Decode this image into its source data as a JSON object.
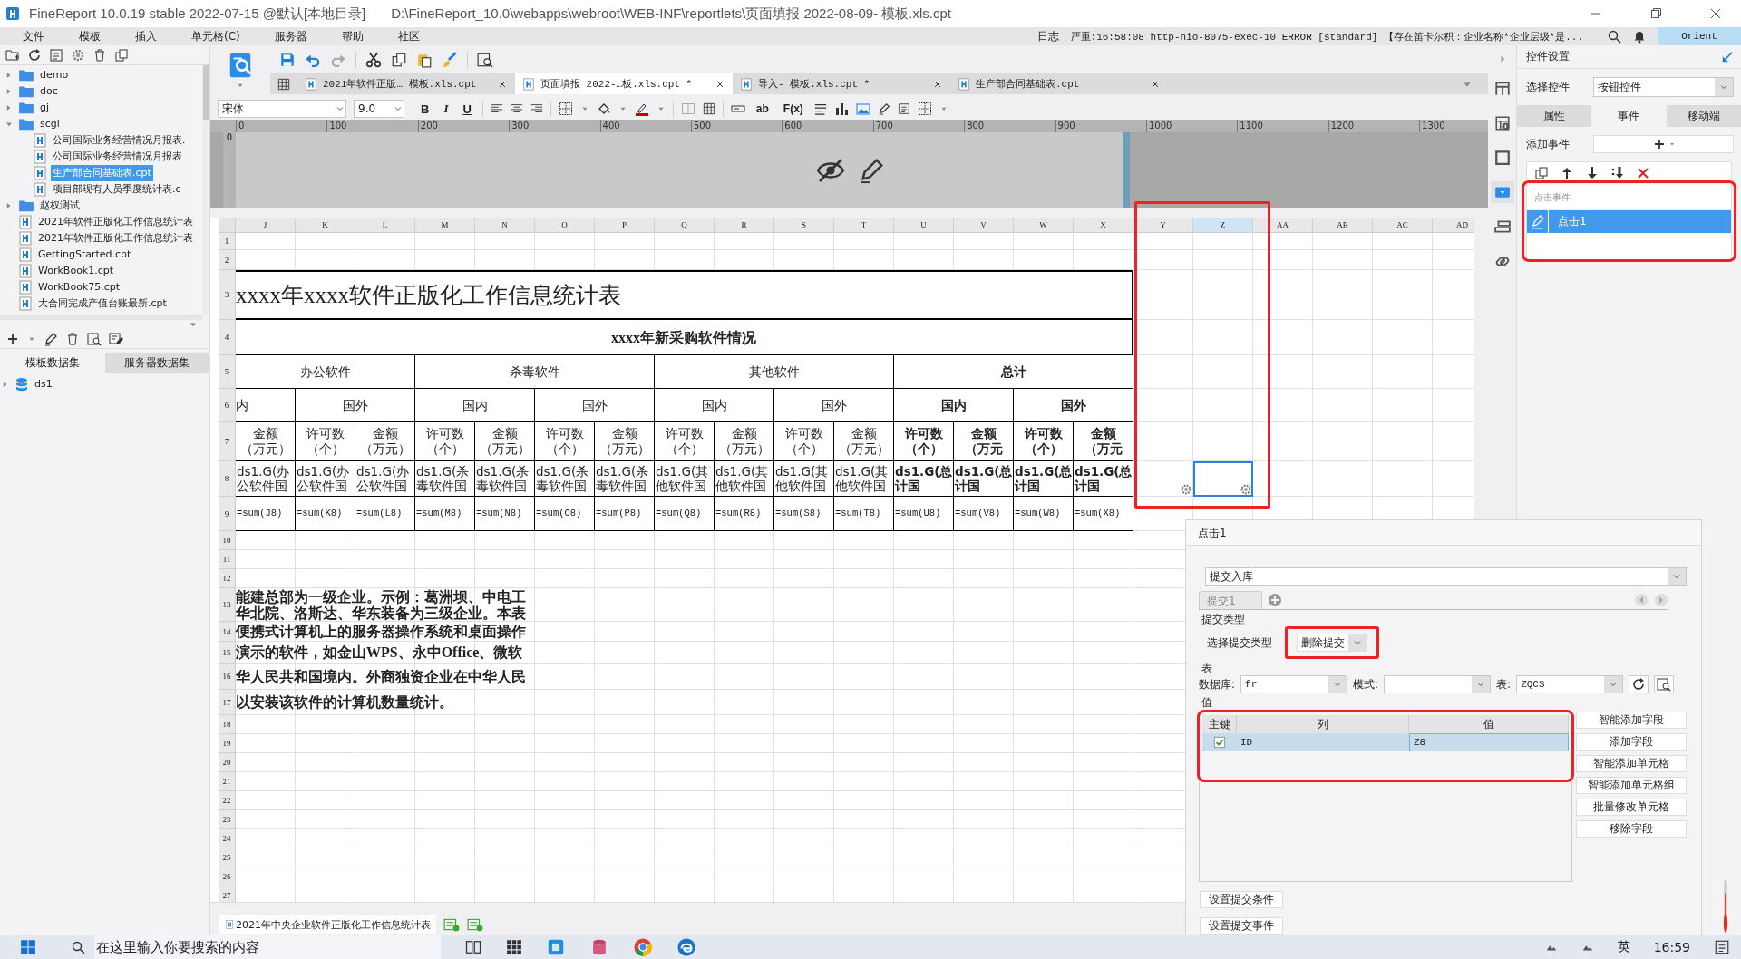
{
  "window": {
    "title": "FineReport 10.0.19 stable 2022-07-15 @默认[本地目录]",
    "path": "D:\\FineReport_10.0\\webapps\\webroot\\WEB-INF\\reportlets\\页面填报 2022-08-09- 模板.xls.cpt"
  },
  "menu": [
    "文件",
    "模板",
    "插入",
    "单元格(C)",
    "服务器",
    "帮助",
    "社区"
  ],
  "log": {
    "label": "日志",
    "message": "严重:16:58:08 http-nio-8075-exec-10 ERROR [standard] 【存在笛卡尔积：企业名称*企业层级*是..."
  },
  "user": "Orient",
  "file_tree": [
    {
      "label": "demo",
      "kind": "folder",
      "expanded": false
    },
    {
      "label": "doc",
      "kind": "folder",
      "expanded": false
    },
    {
      "label": "gj",
      "kind": "folder",
      "expanded": false
    },
    {
      "label": "scgl",
      "kind": "folder",
      "expanded": true,
      "children": [
        {
          "label": "公司国际业务经营情况月报表.",
          "kind": "file",
          "selected": false
        },
        {
          "label": "公司国际业务经营情况月报表",
          "kind": "file",
          "selected": false
        },
        {
          "label": "生产部合同基础表.cpt",
          "kind": "file",
          "selected": true
        },
        {
          "label": "项目部现有人员季度统计表.c",
          "kind": "file",
          "selected": false
        }
      ]
    },
    {
      "label": "赵权测试",
      "kind": "folder",
      "expanded": false
    },
    {
      "label": "2021年软件正版化工作信息统计表",
      "kind": "file",
      "selected": false
    },
    {
      "label": "2021年软件正版化工作信息统计表",
      "kind": "file",
      "selected": false
    },
    {
      "label": "GettingStarted.cpt",
      "kind": "file",
      "selected": false
    },
    {
      "label": "WorkBook1.cpt",
      "kind": "file",
      "selected": false
    },
    {
      "label": "WorkBook75.cpt",
      "kind": "file",
      "selected": false
    },
    {
      "label": "大合同完成产值台账最新.cpt",
      "kind": "file",
      "selected": false
    }
  ],
  "dataset_tabs": [
    {
      "label": "模板数据集",
      "selected": true
    },
    {
      "label": "服务器数据集",
      "selected": false
    }
  ],
  "datasets": [
    "ds1"
  ],
  "template_tabs": [
    {
      "label": "2021年软件正版…  模板.xls.cpt",
      "selected": false
    },
    {
      "label": "页面填报 2022-…板.xls.cpt *",
      "selected": true
    },
    {
      "label": "导入- 模板.xls.cpt *",
      "selected": false
    },
    {
      "label": "生产部合同基础表.cpt",
      "selected": false
    }
  ],
  "format_bar": {
    "font": "宋体",
    "size": "9.0",
    "style_buttons": [
      "B",
      "I",
      "U"
    ],
    "insert_buttons": [
      "ab",
      "F(x)"
    ]
  },
  "ruler": [
    "0",
    "100",
    "200",
    "300",
    "400",
    "500",
    "600",
    "700",
    "800",
    "900",
    "1000",
    "1100",
    "1200",
    "1300"
  ],
  "vertical_ruler": [
    "0"
  ],
  "sheet": {
    "highlight": true,
    "columns": [
      {
        "label": "J",
        "selected": false
      },
      {
        "label": "K",
        "selected": false
      },
      {
        "label": "L",
        "selected": false
      },
      {
        "label": "M",
        "selected": false
      },
      {
        "label": "N",
        "selected": false
      },
      {
        "label": "O",
        "selected": false
      },
      {
        "label": "P",
        "selected": false
      },
      {
        "label": "Q",
        "selected": false
      },
      {
        "label": "R",
        "selected": false
      },
      {
        "label": "S",
        "selected": false
      },
      {
        "label": "T",
        "selected": false
      },
      {
        "label": "U",
        "selected": false
      },
      {
        "label": "V",
        "selected": false
      },
      {
        "label": "W",
        "selected": false
      },
      {
        "label": "X",
        "selected": false
      },
      {
        "label": "Y",
        "selected": false
      },
      {
        "label": "Z",
        "selected": true
      },
      {
        "label": "AA",
        "selected": false
      },
      {
        "label": "AB",
        "selected": false
      },
      {
        "label": "AC",
        "selected": false
      },
      {
        "label": "AD",
        "selected": false
      }
    ],
    "rows": [
      "1",
      "2",
      "3",
      "4",
      "5",
      "6",
      "7",
      "8",
      "9",
      "10",
      "11",
      "12",
      "13",
      "14",
      "15",
      "16",
      "17",
      "18",
      "19",
      "20",
      "21",
      "22",
      "23",
      "24",
      "25",
      "26",
      "27"
    ],
    "cells": [
      {
        "kind": "title",
        "text": "xxxx年xxxx软件正版化工作信息统计表"
      },
      {
        "kind": "subtitle",
        "text": "xxxx年新采购软件情况"
      },
      {
        "kind": "header",
        "text": "办公软件"
      },
      {
        "kind": "header",
        "text": "杀毒软件"
      },
      {
        "kind": "header",
        "text": "其他软件"
      },
      {
        "kind": "header-bold",
        "text": "总计"
      },
      {
        "kind": "header-start",
        "text": "内"
      },
      {
        "kind": "header",
        "text": "国外"
      },
      {
        "kind": "header",
        "text": "国内"
      },
      {
        "kind": "header",
        "text": "国外"
      },
      {
        "kind": "header",
        "text": "国内"
      },
      {
        "kind": "header",
        "text": "国外"
      },
      {
        "kind": "header-bold",
        "text": "国内"
      },
      {
        "kind": "header-bold",
        "text": "国外"
      },
      {
        "kind": "header",
        "text": "金额（万元）"
      },
      {
        "kind": "header",
        "text": "许可数（个）"
      },
      {
        "kind": "header",
        "text": "金额（万元）"
      },
      {
        "kind": "header",
        "text": "许可数（个）"
      },
      {
        "kind": "header",
        "text": "金额（万元）"
      },
      {
        "kind": "header",
        "text": "许可数（个）"
      },
      {
        "kind": "header",
        "text": "金额（万元）"
      },
      {
        "kind": "header",
        "text": "许可数（个）"
      },
      {
        "kind": "header",
        "text": "金额（万元）"
      },
      {
        "kind": "header",
        "text": "许可数（个）"
      },
      {
        "kind": "header",
        "text": "金额（万元）"
      },
      {
        "kind": "header-bold",
        "text": "许可数（个）"
      },
      {
        "kind": "header-bold",
        "text": "金额（万元"
      },
      {
        "kind": "header-bold",
        "text": "许可数（个）"
      },
      {
        "kind": "header-bold",
        "text": "金额（万元"
      },
      {
        "kind": "data",
        "text": "ds1.G(办公软件国"
      },
      {
        "kind": "data",
        "text": "ds1.G(办公软件国"
      },
      {
        "kind": "data",
        "text": "ds1.G(办公软件国"
      },
      {
        "kind": "data",
        "text": "ds1.G(杀毒软件国"
      },
      {
        "kind": "data",
        "text": "ds1.G(杀毒软件国"
      },
      {
        "kind": "data",
        "text": "ds1.G(杀毒软件国"
      },
      {
        "kind": "data",
        "text": "ds1.G(杀毒软件国"
      },
      {
        "kind": "data",
        "text": "ds1.G(其他软件国"
      },
      {
        "kind": "data",
        "text": "ds1.G(其他软件国"
      },
      {
        "kind": "data",
        "text": "ds1.G(其他软件国"
      },
      {
        "kind": "data",
        "text": "ds1.G(其他软件国"
      },
      {
        "kind": "data-bold",
        "text": "ds1.G(总计国"
      },
      {
        "kind": "data-bold",
        "text": "ds1.G(总计国"
      },
      {
        "kind": "data-bold",
        "text": "ds1.G(总计国"
      },
      {
        "kind": "data-bold",
        "text": "ds1.G(总计国"
      },
      {
        "kind": "formula",
        "text": "=sum(J8)"
      },
      {
        "kind": "formula",
        "text": "=sum(K8)"
      },
      {
        "kind": "formula",
        "text": "=sum(L8)"
      },
      {
        "kind": "formula",
        "text": "=sum(M8)"
      },
      {
        "kind": "formula",
        "text": "=sum(N8)"
      },
      {
        "kind": "formula",
        "text": "=sum(O8)"
      },
      {
        "kind": "formula",
        "text": "=sum(P8)"
      },
      {
        "kind": "formula",
        "text": "=sum(Q8)"
      },
      {
        "kind": "formula",
        "text": "=sum(R8)"
      },
      {
        "kind": "formula",
        "text": "=sum(S8)"
      },
      {
        "kind": "formula",
        "text": "=sum(T8)"
      },
      {
        "kind": "formula",
        "text": "=sum(U8)"
      },
      {
        "kind": "formula",
        "text": "=sum(V8)"
      },
      {
        "kind": "formula",
        "text": "=sum(W8)"
      },
      {
        "kind": "formula",
        "text": "=sum(X8)"
      },
      {
        "kind": "note-top",
        "text": "能建总部为一级企业。示例：葛洲坝、中电工"
      },
      {
        "kind": "note-bottom",
        "text": "华北院、洛斯达、华东装备为三级企业。本表"
      },
      {
        "kind": "note",
        "text": "便携式计算机上的服务器操作系统和桌面操作"
      },
      {
        "kind": "note",
        "text": "演示的软件，如金山WPS、永中Office、微软"
      },
      {
        "kind": "note",
        "text": "华人民共和国境内。外商独资企业在中华人民"
      },
      {
        "kind": "note",
        "text": "以安装该软件的计算机数量统计。"
      },
      {
        "kind": "active",
        "selected": true
      }
    ]
  },
  "sheet_tabs": [
    {
      "label": "2021年中央企业软件正版化工作信息统计表",
      "selected": true
    }
  ],
  "side_tools": [
    {
      "kind": "cell",
      "selected": false
    },
    {
      "kind": "cell-info",
      "selected": false
    },
    {
      "kind": "frame",
      "selected": false
    },
    {
      "kind": "widget",
      "selected": true
    },
    {
      "kind": "layout",
      "selected": false
    },
    {
      "kind": "link",
      "selected": false
    }
  ],
  "widget_panel": {
    "title": "控件设置",
    "select_label": "选择控件",
    "select_value": "按钮控件",
    "tabs": [
      {
        "label": "属性",
        "selected": false
      },
      {
        "label": "事件",
        "selected": true
      },
      {
        "label": "移动端",
        "selected": false
      }
    ],
    "add_label": "添加事件",
    "event_group": "点击事件",
    "events": [
      {
        "label": "点击1",
        "selected": true
      }
    ],
    "highlighted": true
  },
  "event_dialog": {
    "title": "点击1",
    "action": "提交入库",
    "submit_tabs": [
      {
        "label": "提交1",
        "selected": true
      }
    ],
    "type_section": "提交类型",
    "type_label": "选择提交类型",
    "type_value": "删除提交",
    "type_highlighted": true,
    "table_section": "表",
    "database_label": "数据库:",
    "database": "fr",
    "schema_label": "模式:",
    "table_label": "表:",
    "table": "ZQCS",
    "value_section": "值",
    "columns": [
      "主键",
      "列",
      "值"
    ],
    "rows": [
      {
        "key": true,
        "column": "ID",
        "value": "Z8",
        "selected": true
      }
    ],
    "values_highlighted": true,
    "side_buttons": [
      "智能添加字段",
      "添加字段",
      "智能添加单元格",
      "智能添加单元格组",
      "批量修改单元格",
      "移除字段"
    ],
    "bottom_buttons": [
      "设置提交条件",
      "设置提交事件"
    ]
  },
  "taskbar": {
    "search_placeholder": "在这里输入你要搜索的内容",
    "ime": "英",
    "time": "16:59"
  }
}
